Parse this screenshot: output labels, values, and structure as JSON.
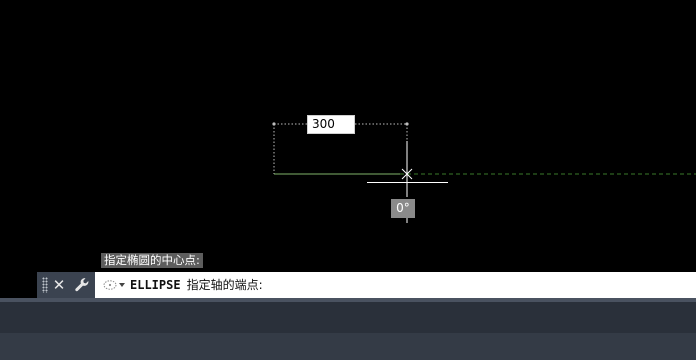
{
  "drawing": {
    "dynamic_input_value": "300",
    "angle_tooltip": "0°"
  },
  "command_history": {
    "last_line": "指定椭圆的中心点:"
  },
  "command_line": {
    "command": "ELLIPSE",
    "prompt": "指定轴的端点:",
    "close_icon": "close-icon",
    "customize_icon": "wrench-icon",
    "recent_icon": "recent-commands-icon"
  },
  "colors": {
    "canvas": "#000000",
    "tracking_line": "#3a7a2a",
    "command_bar": "#3b4350"
  }
}
